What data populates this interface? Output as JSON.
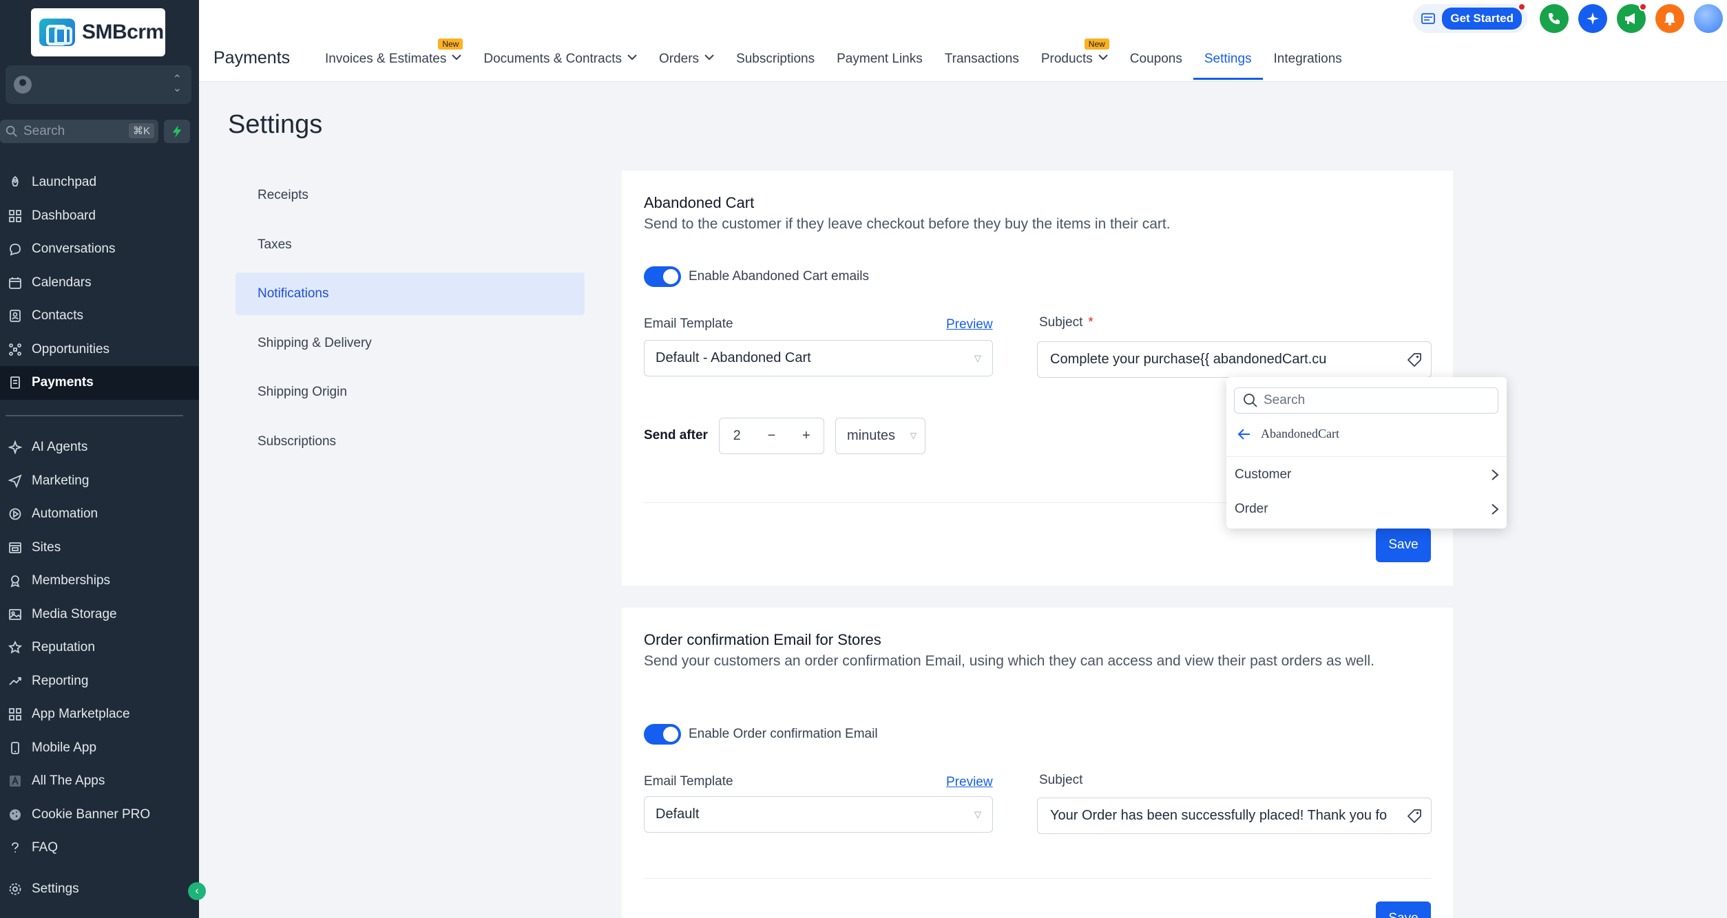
{
  "app": {
    "logo_text": "SMBcrm"
  },
  "sidebar": {
    "search_placeholder": "Search",
    "search_shortcut": "⌘K",
    "items": [
      {
        "label": "Launchpad",
        "icon": "rocket-icon"
      },
      {
        "label": "Dashboard",
        "icon": "grid-icon"
      },
      {
        "label": "Conversations",
        "icon": "chat-icon"
      },
      {
        "label": "Calendars",
        "icon": "calendar-icon"
      },
      {
        "label": "Contacts",
        "icon": "contacts-icon"
      },
      {
        "label": "Opportunities",
        "icon": "opportunities-icon"
      },
      {
        "label": "Payments",
        "icon": "payments-icon",
        "active": true
      }
    ],
    "items2": [
      {
        "label": "AI Agents",
        "icon": "sparkle-icon"
      },
      {
        "label": "Marketing",
        "icon": "send-icon"
      },
      {
        "label": "Automation",
        "icon": "automation-icon"
      },
      {
        "label": "Sites",
        "icon": "sites-icon"
      },
      {
        "label": "Memberships",
        "icon": "award-icon"
      },
      {
        "label": "Media Storage",
        "icon": "image-icon"
      },
      {
        "label": "Reputation",
        "icon": "star-icon"
      },
      {
        "label": "Reporting",
        "icon": "trend-icon"
      },
      {
        "label": "App Marketplace",
        "icon": "apps-icon"
      },
      {
        "label": "Mobile App",
        "icon": "phone-icon"
      },
      {
        "label": "All The Apps",
        "icon": "a-icon"
      },
      {
        "label": "Cookie Banner PRO",
        "icon": "cookie-icon"
      },
      {
        "label": "FAQ",
        "icon": "question-icon"
      }
    ],
    "settings_label": "Settings"
  },
  "header": {
    "title": "Payments",
    "tabs": [
      {
        "label": "Invoices & Estimates",
        "dropdown": true,
        "badge": "New"
      },
      {
        "label": "Documents & Contracts",
        "dropdown": true
      },
      {
        "label": "Orders",
        "dropdown": true
      },
      {
        "label": "Subscriptions"
      },
      {
        "label": "Payment Links"
      },
      {
        "label": "Transactions"
      },
      {
        "label": "Products",
        "dropdown": true,
        "badge": "New"
      },
      {
        "label": "Coupons"
      },
      {
        "label": "Settings",
        "active": true
      },
      {
        "label": "Integrations"
      }
    ],
    "get_started": "Get Started"
  },
  "settings": {
    "title": "Settings",
    "nav": [
      {
        "label": "Receipts"
      },
      {
        "label": "Taxes"
      },
      {
        "label": "Notifications",
        "active": true
      },
      {
        "label": "Shipping & Delivery"
      },
      {
        "label": "Shipping Origin"
      },
      {
        "label": "Subscriptions"
      }
    ]
  },
  "abandoned_cart": {
    "title": "Abandoned Cart",
    "description": "Send to the customer if they leave checkout before they buy the items in their cart.",
    "toggle_label": "Enable Abandoned Cart emails",
    "toggle_on": true,
    "email_template_label": "Email Template",
    "preview_label": "Preview",
    "template_value": "Default - Abandoned Cart",
    "subject_label": "Subject",
    "subject_required": "*",
    "subject_value": "Complete your purchase{{ abandonedCart.cu",
    "send_after_label": "Send after",
    "send_after_value": "2",
    "send_after_unit": "minutes",
    "save_label": "Save"
  },
  "popover": {
    "search_placeholder": "Search",
    "back_label": "AbandonedCart",
    "items": [
      {
        "label": "Customer"
      },
      {
        "label": "Order"
      }
    ]
  },
  "order_confirmation": {
    "title": "Order confirmation Email for Stores",
    "description": "Send your customers an order confirmation Email, using which they can access and view their past orders as well.",
    "toggle_label": "Enable Order confirmation Email",
    "toggle_on": true,
    "email_template_label": "Email Template",
    "preview_label": "Preview",
    "template_value": "Default",
    "subject_label": "Subject",
    "subject_value": "Your Order has been successfully placed! Thank you fo",
    "save_label": "Save"
  },
  "colors": {
    "primary": "#155eef",
    "sidebar_bg": "#1f2b38",
    "active_nav_bg": "#e0e9fb",
    "badge": "#fdb022"
  }
}
